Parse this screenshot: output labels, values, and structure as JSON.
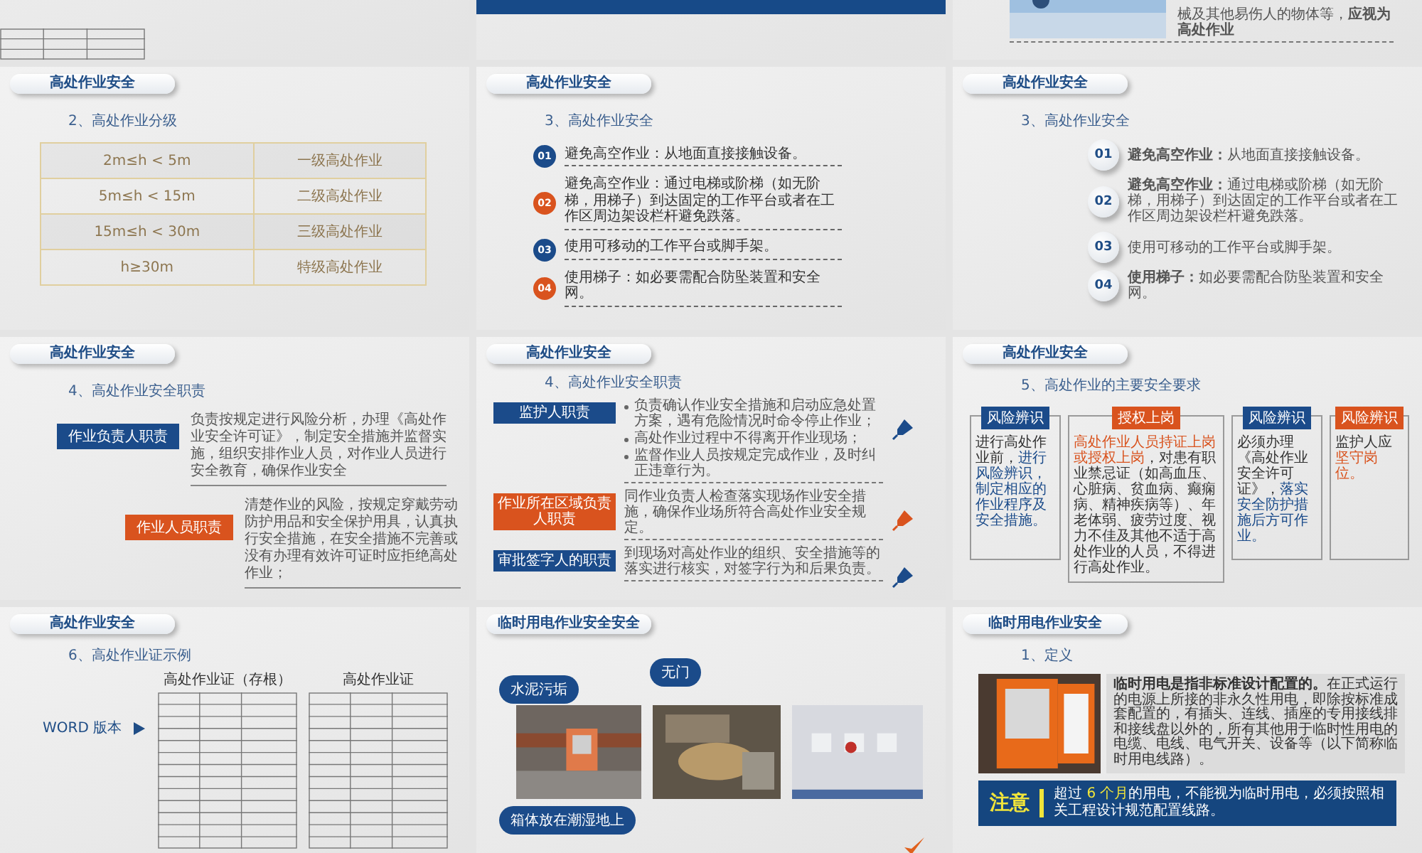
{
  "slides": [
    {
      "kind": "form_tail"
    },
    {
      "kind": "band"
    },
    {
      "kind": "photo_note",
      "note": "械及其他易伤人的物体等，**应视为高处作业**"
    },
    {
      "kind": "table",
      "header": "高处作业安全",
      "subtitle": "2、高处作业分级",
      "rows": [
        [
          "2m≤h < 5m",
          "一级高处作业"
        ],
        [
          "5m≤h < 15m",
          "二级高处作业"
        ],
        [
          "15m≤h < 30m",
          "三级高处作业"
        ],
        [
          "h≥30m",
          "特级高处作业"
        ]
      ]
    },
    {
      "kind": "steps",
      "header": "高处作业安全",
      "subtitle": "3、高处作业安全",
      "items": [
        {
          "number": "01",
          "color": "#1b4b8a",
          "text": "避免高空作业：从地面直接接触设备。"
        },
        {
          "number": "02",
          "color": "#d9531e",
          "text": "避免高空作业：通过电梯或阶梯（如无阶梯，用梯子）到达固定的工作平台或者在工作区周边架设栏杆避免跌落。"
        },
        {
          "number": "03",
          "color": "#1b4b8a",
          "text": "使用可移动的工作平台或脚手架。"
        },
        {
          "number": "04",
          "color": "#d9531e",
          "text": "使用梯子：如必要需配合防坠装置和安全网。"
        }
      ]
    },
    {
      "kind": "badges",
      "header": "高处作业安全",
      "subtitle": "3、高处作业安全",
      "items": [
        {
          "number": "01",
          "text": "**避免高空作业：**从地面直接接触设备。"
        },
        {
          "number": "02",
          "text": "**避免高空作业：**通过电梯或阶梯（如无阶梯，用梯子）到达固定的工作平台或者在工作区周边架设栏杆避免跌落。"
        },
        {
          "number": "03",
          "text": "使用可移动的工作平台或脚手架。"
        },
        {
          "number": "04",
          "text": "**使用梯子：**如必要需配合防坠装置和安全网。"
        }
      ]
    },
    {
      "kind": "duties",
      "header": "高处作业安全",
      "subtitle": "4、高处作业安全职责",
      "items": [
        {
          "role": "作业负责人职责",
          "color": "#1b4b8a",
          "text": "负责按规定进行风险分析，办理《高处作业安全许可证》，制定安全措施并监督实施，组织安排作业人员，对作业人员进行安全教育，确保作业安全"
        },
        {
          "role": "作业人员职责",
          "color": "#d9531e",
          "text": "清楚作业的风险，按规定穿戴劳动防护用品和安全保护用具，认真执行安全措施，在安全措施不完善或没有办理有效许可证时应拒绝高处作业；"
        }
      ]
    },
    {
      "kind": "duty_bullets",
      "header": "高处作业安全",
      "subtitle": "4、高处作业安全职责",
      "items": [
        {
          "role": "监护人职责",
          "color": "#1b4b8a",
          "lines": [
            "负责确认作业安全措施和启动应急处置方案，遇有危险情况时命令停止作业；",
            "高处作业过程中不得离开作业现场；",
            "监督作业人员按规定完成作业，及时纠正违章行为。"
          ]
        },
        {
          "role": "作业所在区域负责人职责",
          "color": "#d9531e",
          "lines": [
            "同作业负责人检查落实现场作业安全措施，确保作业场所符合高处作业安全规定。"
          ]
        },
        {
          "role": "审批签字人的职责",
          "color": "#1b4b8a",
          "lines": [
            "到现场对高处作业的组织、安全措施等的落实进行核实，对签字行为和后果负责。"
          ]
        }
      ]
    },
    {
      "kind": "requirements",
      "header": "高处作业安全",
      "subtitle": "5、高处作业的主要安全要求",
      "items": [
        {
          "label": "风险辨识",
          "color": "#1b4b8a",
          "text": "进行高处作业前，**进行风险辨识，制定相应的作业程序及安全措施。**"
        },
        {
          "label": "授权上岗",
          "color": "#d9531e",
          "text": "**高处作业人员持证上岗或授权上岗**，对患有职业禁忌证（如高血压、心脏病、贫血病、癫痫病、精神疾病等）、年老体弱、疲劳过度、视力不佳及其他不适于高处作业的人员，不得进行高处作业。"
        },
        {
          "label": "风险辨识",
          "color": "#1b4b8a",
          "text": "必须办理《高处作业安全许可证》，**落实安全防护措施后方可作业。**"
        },
        {
          "label": "风险辨识",
          "color": "#d9531e",
          "text": "监护人应**坚守岗位。**"
        }
      ]
    },
    {
      "kind": "permit_example",
      "header": "高处作业安全",
      "subtitle": "6、高处作业证示例",
      "link": "WORD 版本",
      "forms": [
        {
          "title": "高处作业证（存根）"
        },
        {
          "title": "高处作业证"
        }
      ]
    },
    {
      "kind": "photo_callouts",
      "header": "临时用电作业安全安全",
      "callouts": [
        "水泥污垢",
        "无门",
        "箱体放在潮湿地上"
      ]
    },
    {
      "kind": "definition",
      "header": "临时用电作业安全",
      "subtitle": "1、定义",
      "text": "**临时用电是指非标准设计配置的。**在正式运行的电源上所接的非永久性用电，即除按标准成套配置的，有插头、连线、插座的专用接线排和接线盘以外的，所有其他用于临时性用电的电缆、电线、电气开关、设备等（以下简称临时用电线路）。",
      "note_label": "注意",
      "note": "超过 **6 个月**的用电，不能视为临时用电，必须按照相关工程设计规范配置线路。"
    }
  ]
}
